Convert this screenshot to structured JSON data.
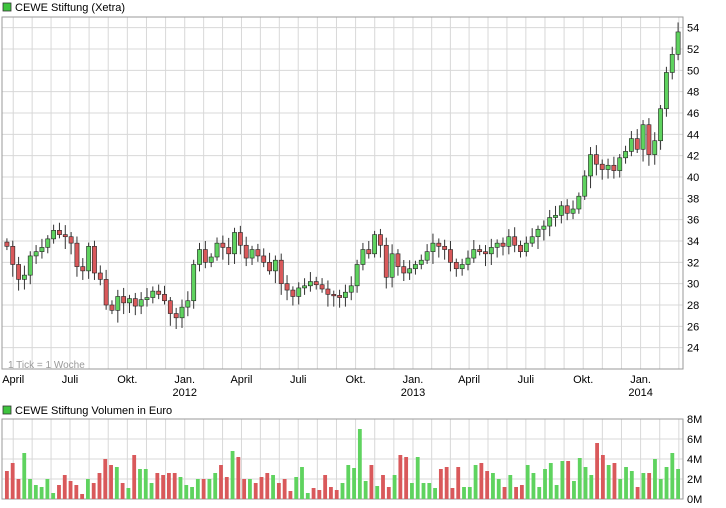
{
  "price_panel": {
    "legend": "CEWE Stiftung (Xetra)",
    "legend_color": "#3ec43e",
    "interval_note": "1 Tick = 1 Woche"
  },
  "volume_panel": {
    "legend": "CEWE Stiftung Volumen in Euro",
    "legend_color": "#3ec43e"
  },
  "colors": {
    "up": "#5fd35f",
    "down": "#d9595b",
    "wick": "#333333",
    "grid": "#d8d8d8",
    "frame": "#9a9a9a"
  },
  "chart_data": [
    {
      "type": "candlestick",
      "title": "CEWE Stiftung (Xetra)",
      "interval": "1 Tick = 1 Woche",
      "x_range": [
        "2011-03-14",
        "2014-03-10"
      ],
      "ylim": [
        22,
        55
      ],
      "y_ticks": [
        24,
        26,
        28,
        30,
        32,
        34,
        36,
        38,
        40,
        42,
        44,
        46,
        48,
        50,
        52,
        54
      ],
      "x_ticks": [
        {
          "label": "April",
          "year": "",
          "date": "2011-04-01"
        },
        {
          "label": "Juli",
          "year": "",
          "date": "2011-07-01"
        },
        {
          "label": "Okt.",
          "year": "",
          "date": "2011-10-01"
        },
        {
          "label": "Jan.",
          "year": "2012",
          "date": "2012-01-01"
        },
        {
          "label": "April",
          "year": "",
          "date": "2012-04-01"
        },
        {
          "label": "Juli",
          "year": "",
          "date": "2012-07-01"
        },
        {
          "label": "Okt.",
          "year": "",
          "date": "2012-10-01"
        },
        {
          "label": "Jan.",
          "year": "2013",
          "date": "2013-01-01"
        },
        {
          "label": "April",
          "year": "",
          "date": "2013-04-01"
        },
        {
          "label": "Juli",
          "year": "",
          "date": "2013-07-01"
        },
        {
          "label": "Okt.",
          "year": "",
          "date": "2013-10-01"
        },
        {
          "label": "Jan.",
          "year": "2014",
          "date": "2014-01-01"
        }
      ],
      "grid": true,
      "closes": [
        33.5,
        31.8,
        30.4,
        30.8,
        32.6,
        33.0,
        33.4,
        34.2,
        35.0,
        34.6,
        34.4,
        33.8,
        31.6,
        31.2,
        33.5,
        31.0,
        30.4,
        28.0,
        27.5,
        28.8,
        28.2,
        28.6,
        27.9,
        28.5,
        28.7,
        29.3,
        29.0,
        28.4,
        27.2,
        26.8,
        27.8,
        28.4,
        31.8,
        33.2,
        32.0,
        32.5,
        33.8,
        33.4,
        32.8,
        34.8,
        33.6,
        32.4,
        33.2,
        32.6,
        32.0,
        31.2,
        32.2,
        30.0,
        29.4,
        28.8,
        29.6,
        29.8,
        30.2,
        29.9,
        29.5,
        29.0,
        28.9,
        28.7,
        29.2,
        29.8,
        31.8,
        33.2,
        32.8,
        34.6,
        33.6,
        30.6,
        32.8,
        31.6,
        31.0,
        31.4,
        31.8,
        32.2,
        33.0,
        33.8,
        33.5,
        33.2,
        32.0,
        31.4,
        31.8,
        32.4,
        33.2,
        33.0,
        32.8,
        33.4,
        33.8,
        33.5,
        34.4,
        33.6,
        33.0,
        33.8,
        34.4,
        35.1,
        35.4,
        36.2,
        36.4,
        37.3,
        36.6,
        37.0,
        38.2,
        40.1,
        42.1,
        41.2,
        40.7,
        41.1,
        40.6,
        41.8,
        42.4,
        43.6,
        42.6,
        44.9,
        42.1,
        43.4,
        46.4,
        49.8,
        51.5,
        53.6
      ],
      "volume_ylim": [
        0,
        8000000
      ],
      "volume_ticks": [
        {
          "label": "0M",
          "value": 0
        },
        {
          "label": "2M",
          "value": 2000000
        },
        {
          "label": "4M",
          "value": 4000000
        },
        {
          "label": "6M",
          "value": 6000000
        },
        {
          "label": "8M",
          "value": 8000000
        }
      ],
      "volumes_m": [
        2.8,
        3.6,
        2.0,
        4.6,
        2.0,
        1.4,
        1.2,
        2.0,
        0.6,
        1.4,
        2.4,
        1.8,
        1.4,
        0.5,
        2.0,
        1.6,
        2.6,
        4.0,
        3.4,
        3.2,
        1.6,
        1.1,
        4.4,
        3.0,
        3.0,
        1.6,
        2.6,
        2.4,
        2.6,
        2.6,
        2.2,
        1.4,
        1.2,
        2.0,
        2.0,
        2.0,
        2.6,
        3.4,
        2.2,
        4.8,
        4.2,
        2.0,
        2.0,
        1.6,
        2.2,
        2.6,
        2.4,
        1.6,
        2.0,
        0.8,
        2.2,
        3.2,
        0.6,
        1.1,
        0.9,
        2.4,
        1.2,
        0.9,
        1.6,
        3.4,
        3.1,
        7.0,
        1.8,
        3.4,
        1.3,
        2.4,
        1.2,
        2.4,
        4.4,
        4.2,
        1.6,
        4.2,
        1.6,
        1.6,
        1.1,
        3.0,
        3.2,
        1.1,
        3.2,
        1.2,
        1.2,
        3.4,
        3.6,
        2.8,
        2.6,
        2.0,
        1.2,
        2.4,
        1.2,
        1.4,
        3.4,
        2.6,
        1.2,
        3.0,
        3.6,
        1.4,
        3.8,
        3.8,
        1.8,
        4.1,
        3.2,
        2.4,
        5.6,
        4.4,
        3.4,
        3.6,
        2.0,
        3.2,
        2.8,
        1.2,
        2.6,
        2.6,
        4.0,
        2.0,
        3.2,
        4.6,
        3.0
      ]
    }
  ]
}
